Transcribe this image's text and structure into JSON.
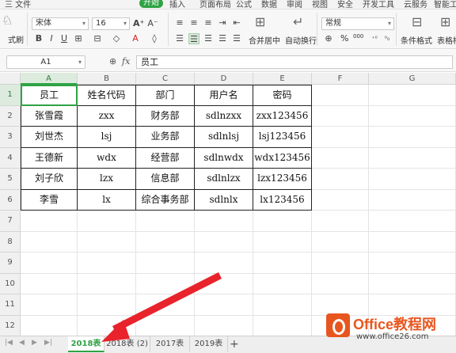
{
  "menu": {
    "items": [
      "三 文件",
      "插入",
      "页面布局",
      "公式",
      "数据",
      "审阅",
      "视图",
      "安全",
      "开发工具",
      "云服务",
      "智能工"
    ],
    "active": "开始"
  },
  "ribbon": {
    "format_painter": "式刷",
    "font_name": "宋体",
    "font_size": "16",
    "number_format": "常规",
    "merge_center": "合并居中",
    "wrap_text": "自动换行",
    "cond_format": "条件格式",
    "table_style": "表格样",
    "percent": "%",
    "thousands": "000"
  },
  "formula_bar": {
    "name_box": "A1",
    "fx": "fx",
    "content": "员工"
  },
  "columns": [
    "A",
    "B",
    "C",
    "D",
    "E",
    "F",
    "G"
  ],
  "rows": [
    "1",
    "2",
    "3",
    "4",
    "5",
    "6",
    "7",
    "8",
    "9",
    "10",
    "11",
    "12"
  ],
  "table": {
    "headers": [
      "员工",
      "姓名代码",
      "部门",
      "用户名",
      "密码"
    ],
    "rows": [
      [
        "张雪霞",
        "zxx",
        "财务部",
        "sdlnzxx",
        "zxx123456"
      ],
      [
        "刘世杰",
        "lsj",
        "业务部",
        "sdlnlsj",
        "lsj123456"
      ],
      [
        "王德新",
        "wdx",
        "经营部",
        "sdlnwdx",
        "wdx123456"
      ],
      [
        "刘子欣",
        "lzx",
        "信息部",
        "sdlnlzx",
        "lzx123456"
      ],
      [
        "李雪",
        "lx",
        "综合事务部",
        "sdlnlx",
        "lx123456"
      ]
    ]
  },
  "sheet_tabs": [
    "2018表",
    "2018表 (2)",
    "2017表",
    "2019表"
  ],
  "active_tab": "2018表",
  "add_sheet": "+",
  "watermark": {
    "title": "Office教程网",
    "url": "www.office26.com"
  },
  "colors": {
    "accent": "#2fa344",
    "arrow": "#e8232b",
    "watermark": "#e8561f"
  }
}
